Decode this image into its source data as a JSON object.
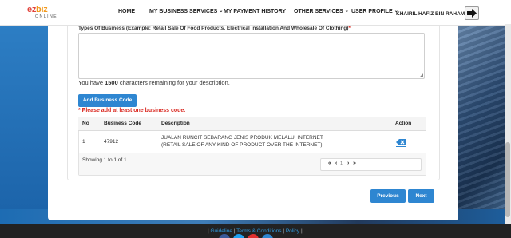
{
  "header": {
    "logo_main": "ez",
    "logo_biz": "biz",
    "logo_sub": "ONLINE",
    "nav": [
      {
        "label": "HOME"
      },
      {
        "label": "MY BUSINESS SERVICES"
      },
      {
        "label": "MY PAYMENT HISTORY"
      },
      {
        "label": "OTHER SERVICES"
      },
      {
        "label": "USER PROFILE"
      }
    ],
    "user_name": "KHAIRIL HAFIZ BIN RAHAMAT"
  },
  "form": {
    "types_label": "Types Of Business (Example: Retail Sale Of Food Products, Electrical Installation And Wholesale Of Clothing)",
    "required_mark": "*",
    "description_value": "",
    "remaining_prefix": "You have ",
    "remaining_count": "1500",
    "remaining_suffix": " characters remaining for your description.",
    "add_button": "Add Business Code",
    "warning": "* Please add at least one business code."
  },
  "table": {
    "headers": [
      "No",
      "Business Code",
      "Description",
      "Action"
    ],
    "rows": [
      {
        "no": "1",
        "code": "47912",
        "desc_line1": "JUALAN RUNCIT SEBARANG JENIS PRODUK MELALUI INTERNET",
        "desc_line2": "(RETAIL SALE OF ANY KIND OF PRODUCT OVER THE INTERNET)",
        "action_icon": "eraser-icon"
      }
    ],
    "showing": "Showing 1 to 1 of 1",
    "pager": {
      "first": "«",
      "prev": "‹",
      "page": "1",
      "next": "›",
      "last": "»"
    }
  },
  "actions": {
    "previous": "Previous",
    "next": "Next"
  },
  "footer": {
    "guideline": "Guideline",
    "terms": "Terms & Conditions",
    "policy": "Policy"
  },
  "colors": {
    "primary": "#2e86d1",
    "danger": "#d9251d",
    "footer_link": "#2f9be0"
  }
}
